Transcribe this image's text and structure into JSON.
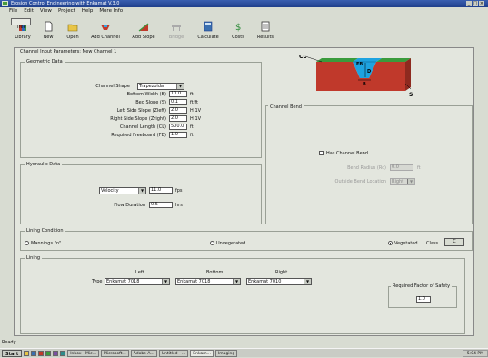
{
  "window": {
    "title": "Erosion Control Engineering with Enkamat V.3.0"
  },
  "menu": [
    "File",
    "Edit",
    "View",
    "Project",
    "Help",
    "More Info"
  ],
  "toolbar": {
    "buttons": [
      {
        "label": "Tree",
        "icon": "tree-icon",
        "enabled": true,
        "selected": true
      },
      {
        "label": "Library",
        "icon": "library-icon",
        "enabled": true
      },
      {
        "label": "New",
        "icon": "new-file-icon",
        "enabled": true
      },
      {
        "label": "Open",
        "icon": "open-folder-icon",
        "enabled": true
      },
      {
        "label": "Add Channel",
        "icon": "add-channel-icon",
        "enabled": true
      },
      {
        "label": "Add Slope",
        "icon": "add-slope-icon",
        "enabled": true
      },
      {
        "label": "Bridge",
        "icon": "bridge-icon",
        "enabled": false
      },
      {
        "label": "Calculate",
        "icon": "calculate-icon",
        "enabled": true
      },
      {
        "label": "Costs",
        "icon": "costs-icon",
        "enabled": true
      },
      {
        "label": "Results",
        "icon": "results-icon",
        "enabled": true
      }
    ]
  },
  "panel": {
    "title": "Channel Input Parameters: New Channel 1"
  },
  "geometric": {
    "title": "Geometric Data",
    "shape_label": "Channel Shape",
    "shape_value": "Trapezoidal",
    "fields": [
      {
        "label": "Bottom Width (B)",
        "value": "10.0",
        "unit": "ft"
      },
      {
        "label": "Bed Slope (S)",
        "value": "0.1",
        "unit": "ft/ft"
      },
      {
        "label": "Left Side Slope (Zleft)",
        "value": "2.0",
        "unit": "H:1V"
      },
      {
        "label": "Right Side Slope (Zright)",
        "value": "2.0",
        "unit": "H:1V"
      },
      {
        "label": "Channel Length (CL)",
        "value": "500.0",
        "unit": "ft"
      },
      {
        "label": "Required Freeboard (FB)",
        "value": "1.0",
        "unit": "ft"
      }
    ]
  },
  "diagram": {
    "labels": {
      "cl": "CL",
      "fb": "FB",
      "d": "D",
      "b": "B",
      "s": "S"
    }
  },
  "hydraulic": {
    "title": "Hydraulic Data",
    "mode_value": "Velocity",
    "mode_input": "11.0",
    "mode_unit": "fps",
    "flow_label": "Flow Duration",
    "flow_value": "0.5",
    "flow_unit": "hrs"
  },
  "bend": {
    "title": "Channel Bend",
    "has_label": "Has Channel Bend",
    "radius_label": "Bend Radius (Rc)",
    "radius_value": "0.0",
    "radius_unit": "ft",
    "location_label": "Outside Bend Location",
    "location_value": "Right"
  },
  "lining_condition": {
    "title": "Lining Condition",
    "options": [
      "Mannings \"n\"",
      "Unvegetated",
      "Vegetated"
    ],
    "class_label": "Class",
    "class_value": "C"
  },
  "lining": {
    "title": "Lining",
    "columns": [
      "Left",
      "Bottom",
      "Right"
    ],
    "type_label": "Type",
    "values": [
      "Enkamat 7018",
      "Enkamat 7018",
      "Enkamat 7010"
    ]
  },
  "safety": {
    "title": "Required Factor of Safety",
    "value": "1.0"
  },
  "status": {
    "text": "Ready"
  },
  "taskbar": {
    "start": "Start",
    "tasks": [
      "Inbox - Mic...",
      "Microsoft...",
      "Adobe A...",
      "Untitled - ...",
      "Enkam...",
      "Imaging"
    ],
    "tray_time": "5:04 PM"
  }
}
